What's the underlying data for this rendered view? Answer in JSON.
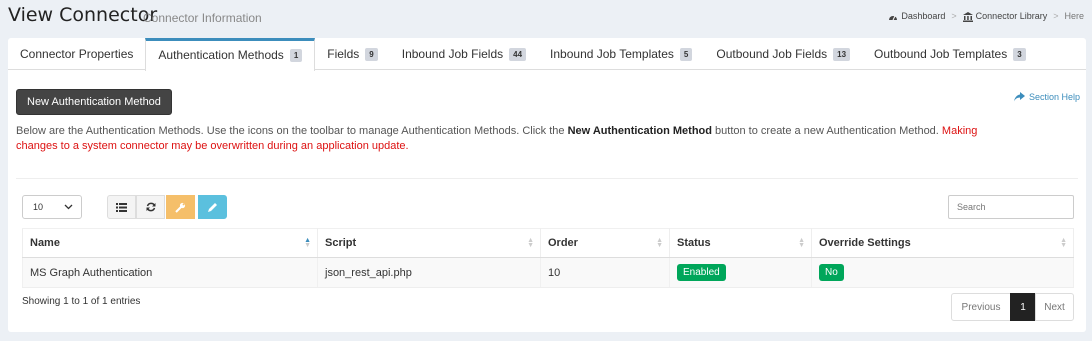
{
  "header": {
    "title": "View Connector",
    "subtitle": "Connector Information",
    "breadcrumbs": [
      {
        "label": "Dashboard",
        "icon": "dashboard-icon"
      },
      {
        "label": "Connector Library",
        "icon": "bank-icon"
      },
      {
        "label": "Here"
      }
    ]
  },
  "tabs": [
    {
      "label": "Connector Properties",
      "count": null
    },
    {
      "label": "Authentication Methods",
      "count": "1",
      "active": true
    },
    {
      "label": "Fields",
      "count": "9"
    },
    {
      "label": "Inbound Job Fields",
      "count": "44"
    },
    {
      "label": "Inbound Job Templates",
      "count": "5"
    },
    {
      "label": "Outbound Job Fields",
      "count": "13"
    },
    {
      "label": "Outbound Job Templates",
      "count": "3"
    }
  ],
  "actions": {
    "new_button": "New Authentication Method",
    "section_help": "Section Help"
  },
  "description": {
    "part1": "Below are the Authentication Methods. Use the icons on the toolbar to manage Authentication Methods. Click the ",
    "bold": "New Authentication Method",
    "part2": " button to create a new Authentication Method. ",
    "warning": "Making changes to a system connector may be overwritten during an application update."
  },
  "toolbar": {
    "page_size": "10",
    "search_placeholder": "Search",
    "icons": [
      "list-icon",
      "refresh-icon",
      "wrench-icon",
      "pencil-icon"
    ]
  },
  "table": {
    "columns": [
      "Name",
      "Script",
      "Order",
      "Status",
      "Override Settings"
    ],
    "rows": [
      {
        "name": "MS Graph Authentication",
        "script": "json_rest_api.php",
        "order": "10",
        "status": "Enabled",
        "override": "No"
      }
    ]
  },
  "footer": {
    "info": "Showing 1 to 1 of 1 entries",
    "prev": "Previous",
    "page": "1",
    "next": "Next"
  },
  "colors": {
    "accent": "#3c8dbc",
    "success": "#00a65a",
    "warning_text": "#dd1111",
    "tool_warning": "#f5bf6a",
    "tool_info": "#5bc0de"
  }
}
